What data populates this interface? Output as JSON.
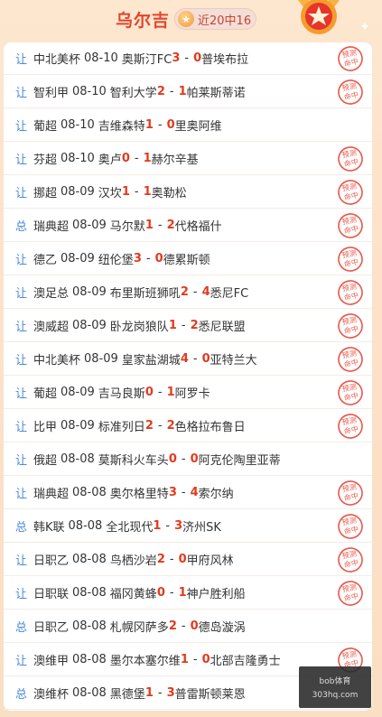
{
  "header": {
    "title": "乌尔吉",
    "badge_icon": "star-icon",
    "badge_text": "近20中16"
  },
  "stamp_text": "预测命中",
  "rows": [
    {
      "type": "让",
      "league": "中北美杯",
      "date": "08-10",
      "home": "奥斯汀FC",
      "home_score": "3",
      "away_score": "0",
      "away": "普埃布拉",
      "hit": true
    },
    {
      "type": "让",
      "league": "智利甲",
      "date": "08-10",
      "home": "智利大学",
      "home_score": "2",
      "away_score": "1",
      "away": "帕莱斯蒂诺",
      "hit": true
    },
    {
      "type": "让",
      "league": "葡超",
      "date": "08-10",
      "home": "吉维森特",
      "home_score": "1",
      "away_score": "0",
      "away": "里奥阿维",
      "hit": false
    },
    {
      "type": "让",
      "league": "芬超",
      "date": "08-10",
      "home": "奥卢",
      "home_score": "0",
      "away_score": "1",
      "away": "赫尔辛基",
      "hit": true
    },
    {
      "type": "让",
      "league": "挪超",
      "date": "08-09",
      "home": "汉坎",
      "home_score": "1",
      "away_score": "1",
      "away": "奥勒松",
      "hit": true
    },
    {
      "type": "总",
      "league": "瑞典超",
      "date": "08-09",
      "home": "马尔默",
      "home_score": "1",
      "away_score": "2",
      "away": "代格福什",
      "hit": true
    },
    {
      "type": "让",
      "league": "德乙",
      "date": "08-09",
      "home": "纽伦堡",
      "home_score": "3",
      "away_score": "0",
      "away": "德累斯顿",
      "hit": true
    },
    {
      "type": "让",
      "league": "澳足总",
      "date": "08-09",
      "home": "布里斯班狮吼",
      "home_score": "2",
      "away_score": "4",
      "away": "悉尼FC",
      "hit": true
    },
    {
      "type": "让",
      "league": "澳威超",
      "date": "08-09",
      "home": "卧龙岗狼队",
      "home_score": "1",
      "away_score": "2",
      "away": "悉尼联盟",
      "hit": true
    },
    {
      "type": "让",
      "league": "中北美杯",
      "date": "08-09",
      "home": "皇家盐湖城",
      "home_score": "4",
      "away_score": "0",
      "away": "亚特兰大",
      "hit": true
    },
    {
      "type": "让",
      "league": "葡超",
      "date": "08-09",
      "home": "吉马良斯",
      "home_score": "0",
      "away_score": "1",
      "away": "阿罗卡",
      "hit": true
    },
    {
      "type": "让",
      "league": "比甲",
      "date": "08-09",
      "home": "标准列日",
      "home_score": "2",
      "away_score": "2",
      "away": "色格拉布鲁日",
      "hit": true
    },
    {
      "type": "让",
      "league": "俄超",
      "date": "08-08",
      "home": "莫斯科火车头",
      "home_score": "0",
      "away_score": "0",
      "away": "阿克伦陶里亚蒂",
      "hit": false
    },
    {
      "type": "让",
      "league": "瑞典超",
      "date": "08-08",
      "home": "奥尔格里特",
      "home_score": "3",
      "away_score": "4",
      "away": "索尔纳",
      "hit": true
    },
    {
      "type": "总",
      "league": "韩K联",
      "date": "08-08",
      "home": "全北现代",
      "home_score": "1",
      "away_score": "3",
      "away": "济州SK",
      "hit": true
    },
    {
      "type": "让",
      "league": "日职乙",
      "date": "08-08",
      "home": "鸟栖沙岩",
      "home_score": "2",
      "away_score": "0",
      "away": "甲府风林",
      "hit": true
    },
    {
      "type": "让",
      "league": "日职联",
      "date": "08-08",
      "home": "福冈黄蜂",
      "home_score": "0",
      "away_score": "1",
      "away": "神户胜利船",
      "hit": true
    },
    {
      "type": "总",
      "league": "日职乙",
      "date": "08-08",
      "home": "札幌冈萨多",
      "home_score": "2",
      "away_score": "0",
      "away": "德岛漩涡",
      "hit": false
    },
    {
      "type": "让",
      "league": "澳维甲",
      "date": "08-08",
      "home": "墨尔本塞尔维",
      "home_score": "1",
      "away_score": "0",
      "away": "北部吉隆勇士",
      "hit": true
    },
    {
      "type": "总",
      "league": "澳维杯",
      "date": "08-08",
      "home": "黑德堡",
      "home_score": "1",
      "away_score": "3",
      "away": "普雷斯顿莱恩",
      "hit": false
    }
  ],
  "watermark": {
    "line1": "bob体育",
    "line2": "303hq.com"
  },
  "colors": {
    "accent": "#e2452e",
    "score": "#e23a1e",
    "type_blue": "#4a8ad8",
    "stamp": "#e8584a"
  }
}
